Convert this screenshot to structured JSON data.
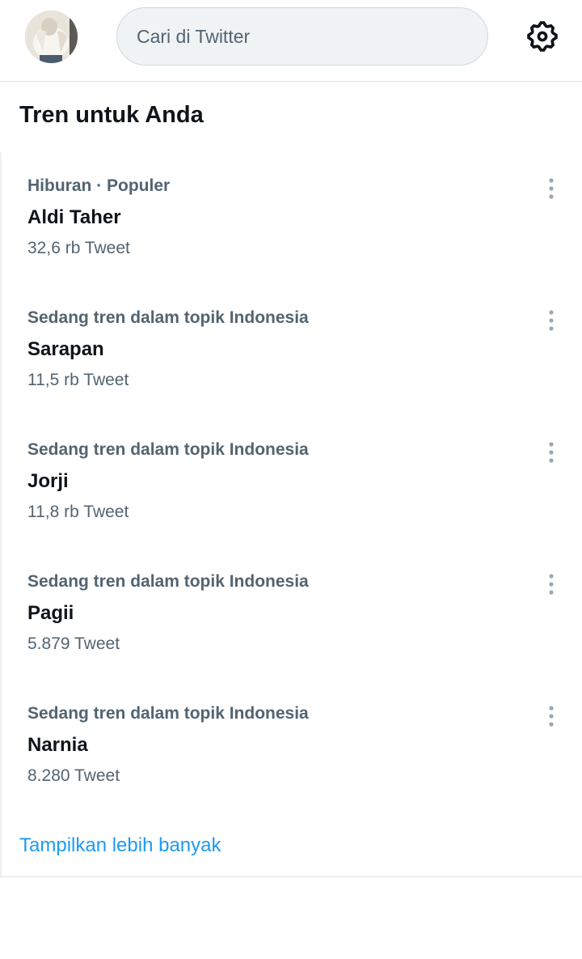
{
  "header": {
    "avatar_icon": "profile-avatar",
    "search_placeholder": "Cari di Twitter",
    "settings_icon": "gear-icon"
  },
  "section": {
    "title": "Tren untuk Anda"
  },
  "trends": [
    {
      "meta": "Hiburan · Populer",
      "name": "Aldi Taher",
      "count": "32,6 rb Tweet"
    },
    {
      "meta": "Sedang tren dalam topik Indonesia",
      "name": "Sarapan",
      "count": "11,5 rb Tweet"
    },
    {
      "meta": "Sedang tren dalam topik Indonesia",
      "name": "Jorji",
      "count": "11,8 rb Tweet"
    },
    {
      "meta": "Sedang tren dalam topik Indonesia",
      "name": "Pagii",
      "count": "5.879 Tweet"
    },
    {
      "meta": "Sedang tren dalam topik Indonesia",
      "name": "Narnia",
      "count": "8.280 Tweet"
    }
  ],
  "show_more": "Tampilkan lebih banyak",
  "colors": {
    "accent": "#1d9bf0",
    "secondary_text": "#536471",
    "primary_text": "#0f1419"
  }
}
